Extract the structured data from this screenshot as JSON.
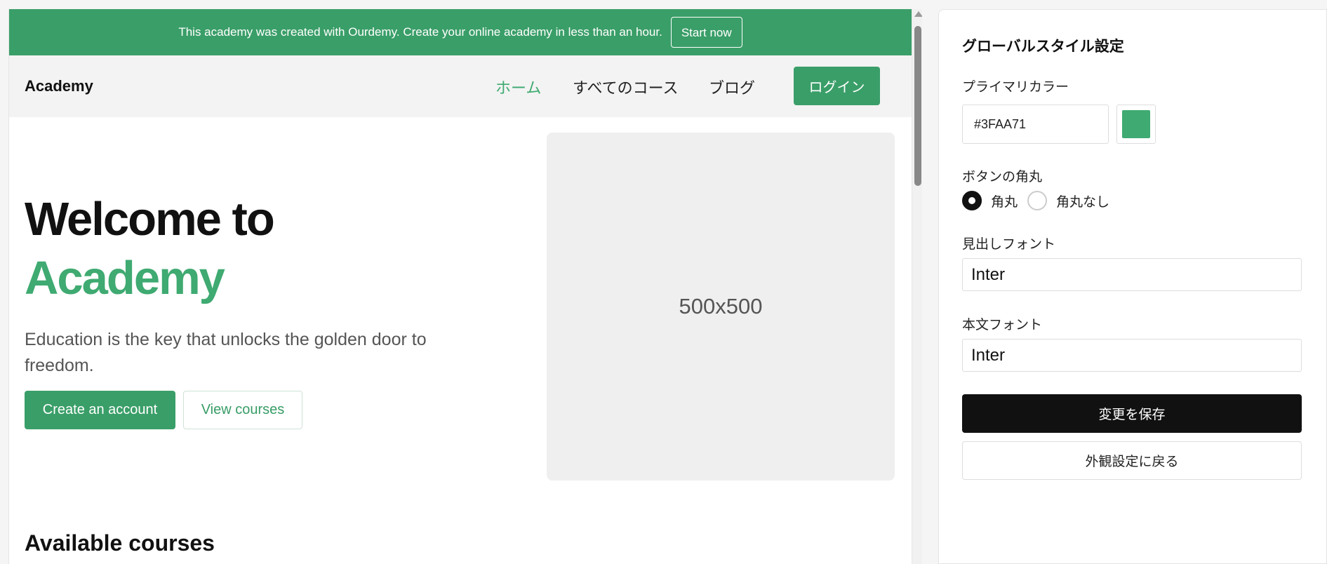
{
  "theme": {
    "primary": "#3FAA71",
    "primary_dark": "#379C66",
    "button_primary": "#3A9E68"
  },
  "banner": {
    "text": "This academy was created with Ourdemy. Create your online academy in less than an hour.",
    "button_label": "Start now"
  },
  "site_header": {
    "logo": "Academy",
    "nav": [
      {
        "label": "ホーム",
        "active": true
      },
      {
        "label": "すべてのコース",
        "active": false
      },
      {
        "label": "ブログ",
        "active": false
      }
    ],
    "login_label": "ログイン"
  },
  "hero": {
    "title_line1": "Welcome to",
    "title_line2": "Academy",
    "subtitle": "Education is the key that unlocks the golden door to freedom.",
    "primary_cta": "Create an account",
    "secondary_cta": "View courses",
    "image_placeholder": "500x500"
  },
  "courses": {
    "heading": "Available courses"
  },
  "panel": {
    "title": "グローバルスタイル設定",
    "primary_color_label": "プライマリカラー",
    "primary_color_value": "#3FAA71",
    "button_radius_label": "ボタンの角丸",
    "radius_options": [
      {
        "label": "角丸",
        "checked": true
      },
      {
        "label": "角丸なし",
        "checked": false
      }
    ],
    "heading_font_label": "見出しフォント",
    "heading_font_value": "Inter",
    "body_font_label": "本文フォント",
    "body_font_value": "Inter",
    "save_label": "変更を保存",
    "back_label": "外観設定に戻る"
  }
}
